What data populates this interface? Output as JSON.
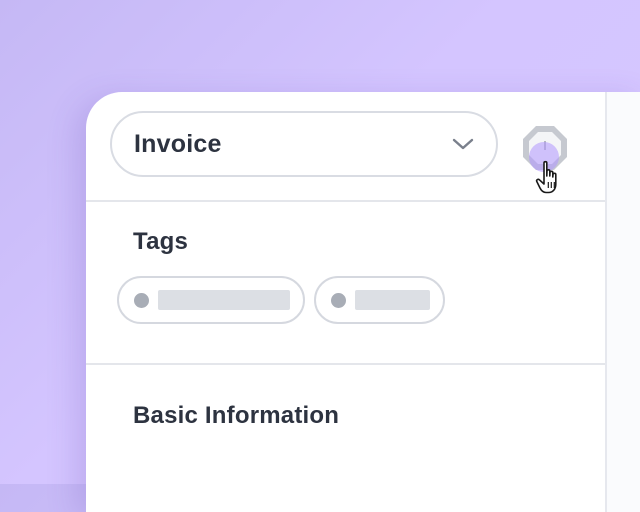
{
  "type_select": {
    "value": "Invoice",
    "chevron_icon": "chevron-down-icon"
  },
  "settings_button": {
    "icon": "octagon-settings-icon"
  },
  "cursor": {
    "icon": "hand-pointer-cursor-icon"
  },
  "tags_section": {
    "title": "Tags",
    "tags": [
      {
        "icon": "dot-icon"
      },
      {
        "icon": "dot-icon"
      }
    ]
  },
  "basic_info_section": {
    "title": "Basic Information"
  },
  "colors": {
    "background": "#d4c5ff",
    "accent": "#b096ff",
    "text": "#2d3340",
    "border": "#d9dce3"
  }
}
